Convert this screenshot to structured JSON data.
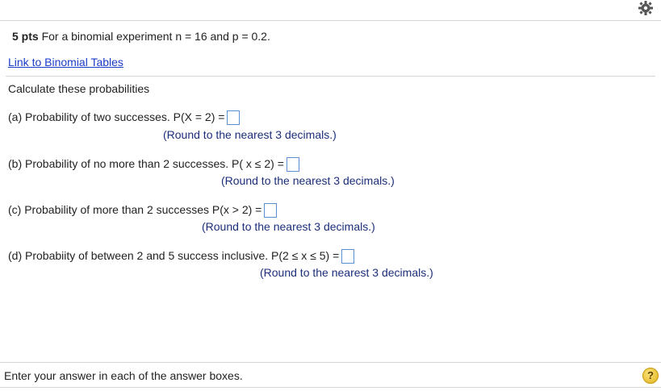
{
  "header": {
    "gear_icon": "gear-icon"
  },
  "question": {
    "pts": "5 pts",
    "prompt": "For a binomial experiment n = 16 and p = 0.2.",
    "link_text": "Link to Binomial Tables",
    "instruction": "Calculate these probabilities",
    "parts": [
      {
        "label": "(a) Probability of two successes. P(X = 2) =",
        "note": "(Round to the nearest 3 decimals.)"
      },
      {
        "label": "(b) Probability of no more than 2 successes.  P( x ≤ 2) =",
        "note": "(Round to the nearest 3 decimals.)"
      },
      {
        "label": "(c) Probability of  more than 2 successes P(x > 2) =",
        "note": "(Round to the nearest 3 decimals.)"
      },
      {
        "label": "(d) Probabiity of between 2 and 5 success inclusive. P(2 ≤ x ≤ 5) =",
        "note": "(Round to the nearest 3 decimals.)"
      }
    ]
  },
  "footer": {
    "instruction": "Enter your answer in each of the answer boxes.",
    "help_label": "?"
  },
  "colors": {
    "link": "#1a3cc8",
    "note": "#1c2e7a",
    "input_border": "#5b8fd1",
    "help": "#e0b31c"
  }
}
